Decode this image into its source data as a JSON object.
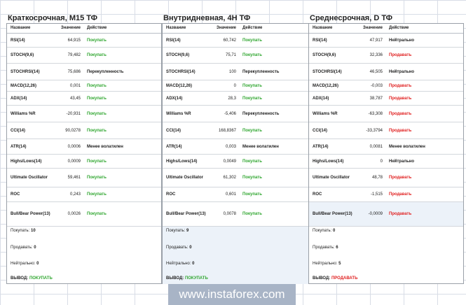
{
  "headers": {
    "name": "Название",
    "value": "Значение",
    "action": "Действие"
  },
  "panels": [
    {
      "title": "Краткосрочная, М15 ТФ",
      "rows": [
        {
          "name": "RSI(14)",
          "value": "64,915",
          "action": "Покупать",
          "kind": "buy"
        },
        {
          "name": "STOCH(9,6)",
          "value": "79,482",
          "action": "Покупать",
          "kind": "buy"
        },
        {
          "name": "STOCHRSI(14)",
          "value": "75,686",
          "action": "Перекупленность",
          "kind": "neut"
        },
        {
          "name": "MACD(12,26)",
          "value": "0,001",
          "action": "Покупать",
          "kind": "buy"
        },
        {
          "name": "ADX(14)",
          "value": "43,45",
          "action": "Покупать",
          "kind": "buy"
        },
        {
          "name": "Williams %R",
          "value": "-20,931",
          "action": "Покупать",
          "kind": "buy"
        },
        {
          "name": "CCI(14)",
          "value": "90,0278",
          "action": "Покупать",
          "kind": "buy"
        },
        {
          "name": "ATR(14)",
          "value": "0,0006",
          "action": "Менее волатилен",
          "kind": "neut"
        },
        {
          "name": "Highs/Lows(14)",
          "value": "0,0009",
          "action": "Покупать",
          "kind": "buy"
        },
        {
          "name": "Ultimate Oscillator",
          "value": "59,461",
          "action": "Покупать",
          "kind": "buy"
        },
        {
          "name": "ROC",
          "value": "0,243",
          "action": "Покупать",
          "kind": "buy"
        },
        {
          "name": "Bull/Bear Power(13)",
          "value": "0,0026",
          "action": "Покупать",
          "kind": "buy"
        }
      ],
      "summary": {
        "buy_label": "Покупать:",
        "buy_count": "10",
        "sell_label": "Продавать:",
        "sell_count": "0",
        "neutral_label": "Нейтрально:",
        "neutral_count": "0",
        "verdict_label": "ВЫВОД:",
        "verdict_value": "ПОКУПАТЬ",
        "verdict_kind": "buy"
      }
    },
    {
      "title": "Внутридневная, 4Н ТФ",
      "rows": [
        {
          "name": "RSI(14)",
          "value": "60,742",
          "action": "Покупать",
          "kind": "buy"
        },
        {
          "name": "STOCH(9,6)",
          "value": "75,71",
          "action": "Покупать",
          "kind": "buy"
        },
        {
          "name": "STOCHRSI(14)",
          "value": "100",
          "action": "Перекупленность",
          "kind": "neut"
        },
        {
          "name": "MACD(12,26)",
          "value": "0",
          "action": "Покупать",
          "kind": "buy"
        },
        {
          "name": "ADX(14)",
          "value": "28,3",
          "action": "Покупать",
          "kind": "buy"
        },
        {
          "name": "Williams %R",
          "value": "-5,406",
          "action": "Перекупленность",
          "kind": "neut"
        },
        {
          "name": "CCI(14)",
          "value": "168,8367",
          "action": "Покупать",
          "kind": "buy"
        },
        {
          "name": "ATR(14)",
          "value": "0,003",
          "action": "Менее волатилен",
          "kind": "neut"
        },
        {
          "name": "Highs/Lows(14)",
          "value": "0,0049",
          "action": "Покупать",
          "kind": "buy"
        },
        {
          "name": "Ultimate Oscillator",
          "value": "61,302",
          "action": "Покупать",
          "kind": "buy"
        },
        {
          "name": "ROC",
          "value": "0,601",
          "action": "Покупать",
          "kind": "buy"
        },
        {
          "name": "Bull/Bear Power(13)",
          "value": "0,0078",
          "action": "Покупать",
          "kind": "buy"
        }
      ],
      "summary": {
        "buy_label": "Покупать:",
        "buy_count": "9",
        "sell_label": "Продавать:",
        "sell_count": "0",
        "neutral_label": "Нейтрально:",
        "neutral_count": "0",
        "verdict_label": "ВЫВОД:",
        "verdict_value": "ПОКУПАТЬ",
        "verdict_kind": "buy"
      }
    },
    {
      "title": "Среднесрочная, D ТФ",
      "rows": [
        {
          "name": "RSI(14)",
          "value": "47,917",
          "action": "Нейтрально",
          "kind": "neut"
        },
        {
          "name": "STOCH(9,6)",
          "value": "32,336",
          "action": "Продавать",
          "kind": "sell"
        },
        {
          "name": "STOCHRSI(14)",
          "value": "46,505",
          "action": "Нейтрально",
          "kind": "neut"
        },
        {
          "name": "MACD(12,26)",
          "value": "-0,003",
          "action": "Продавать",
          "kind": "sell"
        },
        {
          "name": "ADX(14)",
          "value": "38,787",
          "action": "Продавать",
          "kind": "sell"
        },
        {
          "name": "Williams %R",
          "value": "-63,308",
          "action": "Продавать",
          "kind": "sell"
        },
        {
          "name": "CCI(14)",
          "value": "-33,3794",
          "action": "Продавать",
          "kind": "sell"
        },
        {
          "name": "ATR(14)",
          "value": "0,0081",
          "action": "Менее волатилен",
          "kind": "neut"
        },
        {
          "name": "Highs/Lows(14)",
          "value": "0",
          "action": "Нейтрально",
          "kind": "neut"
        },
        {
          "name": "Ultimate Oscillator",
          "value": "48,78",
          "action": "Продавать",
          "kind": "sell"
        },
        {
          "name": "ROC",
          "value": "-1,515",
          "action": "Продавать",
          "kind": "sell"
        },
        {
          "name": "Bull/Bear Power(13)",
          "value": "-0,0009",
          "action": "Продавать",
          "kind": "sell"
        }
      ],
      "summary": {
        "buy_label": "Покупать:",
        "buy_count": "0",
        "sell_label": "Продавать:",
        "sell_count": "6",
        "neutral_label": "Нейтрально:",
        "neutral_count": "5",
        "verdict_label": "ВЫВОД:",
        "verdict_value": "ПРОДАВАТЬ",
        "verdict_kind": "sell"
      }
    }
  ],
  "watermark": "www.instaforex.com",
  "colors": {
    "buy": "#2fa62f",
    "sell": "#e02020",
    "highlight": "#ecf2f9"
  }
}
